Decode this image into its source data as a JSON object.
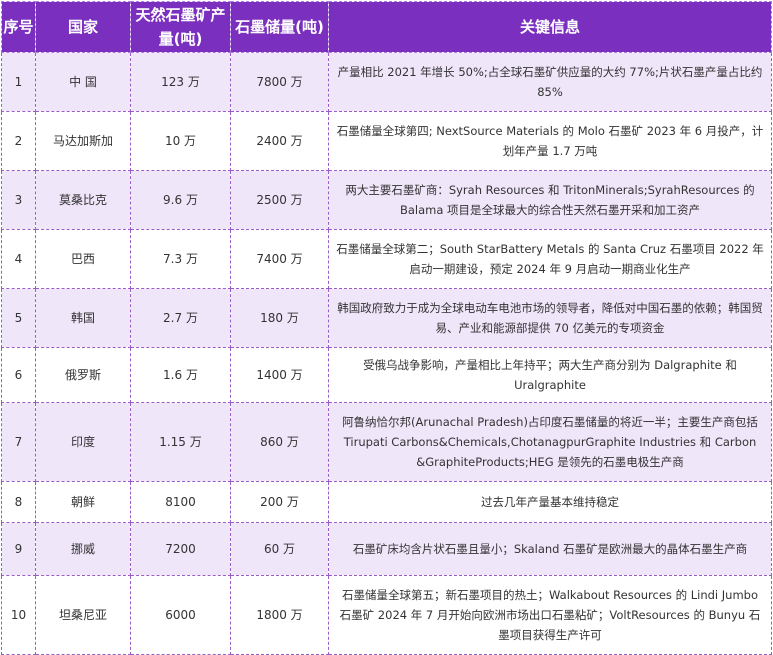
{
  "header": {
    "seq": "序号",
    "country": "国家",
    "production": "天然石墨矿产量(吨)",
    "reserves": "石墨储量(吨)",
    "info": "关键信息"
  },
  "rows": [
    {
      "seq": "1",
      "country": "中 国",
      "production": "123 万",
      "reserves": "7800 万",
      "info": "产量相比 2021 年增长 50%;占全球石墨矿供应量的大约 77%;片状石墨产量占比约 85%"
    },
    {
      "seq": "2",
      "country": "马达加斯加",
      "production": "10 万",
      "reserves": "2400 万",
      "info": "石墨储量全球第四; NextSource Materials 的 Molo 石墨矿 2023 年 6 月投产，计划年产量 1.7 万吨"
    },
    {
      "seq": "3",
      "country": "莫桑比克",
      "production": "9.6 万",
      "reserves": "2500 万",
      "info": "两大主要石墨矿商：Syrah Resources 和 TritonMinerals;SyrahResources 的 Balama 项目是全球最大的综合性天然石墨开采和加工资产"
    },
    {
      "seq": "4",
      "country": "巴西",
      "production": "7.3 万",
      "reserves": "7400 万",
      "info": "石墨储量全球第二；South StarBattery Metals 的 Santa Cruz 石墨项目 2022 年启动一期建设，预定 2024 年 9 月启动一期商业化生产"
    },
    {
      "seq": "5",
      "country": "韩国",
      "production": "2.7 万",
      "reserves": "180 万",
      "info": "韩国政府致力于成为全球电动车电池市场的领导者，降低对中国石墨的依赖；韩国贸易、产业和能源部提供 70 亿美元的专项资金"
    },
    {
      "seq": "6",
      "country": "俄罗斯",
      "production": "1.6 万",
      "reserves": "1400 万",
      "info": "受俄乌战争影响，产量相比上年持平；两大生产商分别为 Dalgraphite 和 Uralgraphite"
    },
    {
      "seq": "7",
      "country": "印度",
      "production": "1.15 万",
      "reserves": "860 万",
      "info": "阿鲁纳恰尔邦(Arunachal Pradesh)占印度石墨储量的将近一半；主要生产商包括 Tirupati Carbons&Chemicals,ChotanagpurGraphite Industries 和 Carbon &GraphiteProducts;HEG 是领先的石墨电极生产商"
    },
    {
      "seq": "8",
      "country": "朝鲜",
      "production": "8100",
      "reserves": "200 万",
      "info": "过去几年产量基本维持稳定"
    },
    {
      "seq": "9",
      "country": "挪威",
      "production": "7200",
      "reserves": "60 万",
      "info": "石墨矿床均含片状石墨且量小；Skaland 石墨矿是欧洲最大的晶体石墨生产商"
    },
    {
      "seq": "10",
      "country": "坦桑尼亚",
      "production": "6000",
      "reserves": "1800 万",
      "info": "石墨储量全球第五；新石墨项目的热土；Walkabout Resources 的 Lindi Jumbo 石墨矿 2024 年 7 月开始向欧洲市场出口石墨粘矿；VoltResources 的 Bunyu 石墨项目获得生产许可"
    }
  ]
}
